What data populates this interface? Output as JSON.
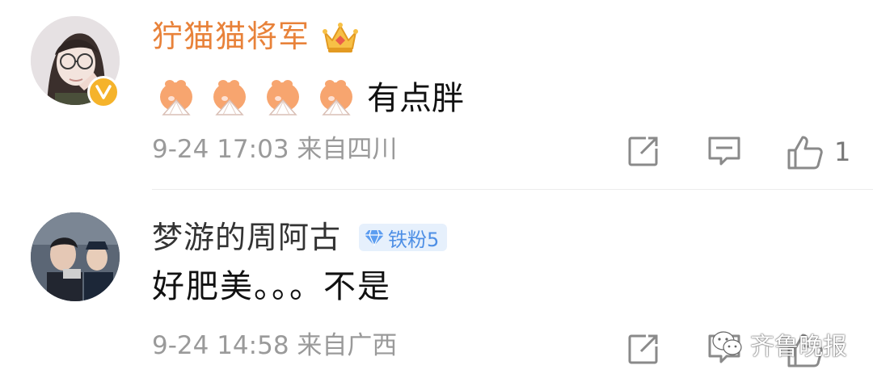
{
  "comments": [
    {
      "username": "狞猫猫将军",
      "emoji_count": 4,
      "text": "有点胖",
      "timestamp": "9-24 17:03",
      "location": "来自四川",
      "likes": "1",
      "badges": [
        "vip-crown-icon",
        "verified-v-icon"
      ]
    },
    {
      "username": "梦游的周阿古",
      "fan_badge": "铁粉5",
      "text": "好肥美。。。不是",
      "timestamp": "9-24 14:58",
      "location": "来自广西"
    }
  ],
  "watermark": "齐鲁晚报",
  "colors": {
    "username_vip": "#e8823a",
    "username": "#333333",
    "meta": "#9a9a9a",
    "fan_badge_bg": "#e6f0fc",
    "fan_badge_text": "#4e8fe5",
    "verified_badge": "#f5b32b"
  },
  "icons": [
    "share-icon",
    "comment-icon",
    "like-thumb-icon",
    "diamond-icon",
    "wechat-icon"
  ]
}
